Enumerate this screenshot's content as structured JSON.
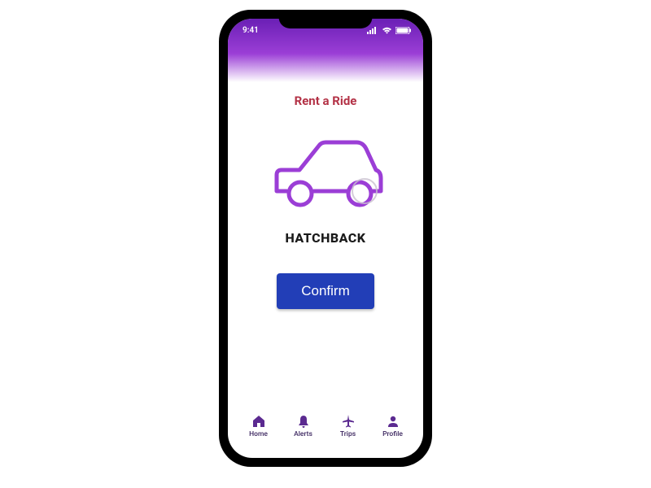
{
  "status": {
    "time": "9:41"
  },
  "header": {
    "title": "Rent a Ride"
  },
  "vehicle": {
    "type": "HATCHBACK"
  },
  "actions": {
    "confirm": "Confirm"
  },
  "nav": {
    "home": "Home",
    "alerts": "Alerts",
    "trips": "Trips",
    "profile": "Profile"
  },
  "colors": {
    "accent_purple": "#9b3ed6",
    "title_red": "#b33246",
    "button_blue": "#223eb7",
    "nav_purple": "#5b2a90"
  }
}
